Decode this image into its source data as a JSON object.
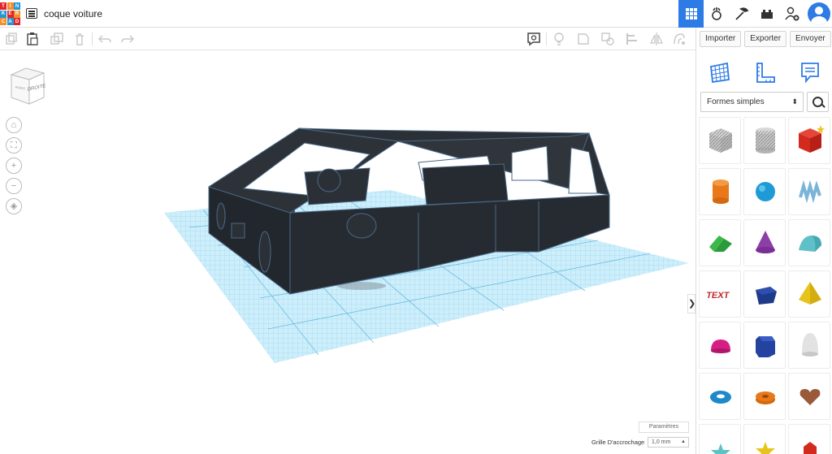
{
  "header": {
    "logo_letters": [
      "T",
      "I",
      "N",
      "K",
      "E",
      "R",
      "C",
      "A",
      "D"
    ],
    "logo_colors": [
      "#e2232a",
      "#f38f2a",
      "#2596d5",
      "#2596d5",
      "#e2232a",
      "#f38f2a",
      "#f38f2a",
      "#2596d5",
      "#e2232a"
    ],
    "title": "coque voiture",
    "right_icons": [
      "grid-view-icon",
      "simulate-icon",
      "build-icon",
      "bricks-icon",
      "add-user-icon",
      "avatar"
    ]
  },
  "toolbar": {
    "left_tools": [
      "copy-icon",
      "paste-icon",
      "duplicate-icon",
      "delete-icon",
      "undo-icon",
      "redo-icon"
    ],
    "right_tools": [
      "note-icon",
      "light-icon",
      "shape-icon",
      "group-icon",
      "align-icon",
      "mirror-icon",
      "cruise-icon"
    ]
  },
  "panel": {
    "import_label": "Importer",
    "export_label": "Exporter",
    "send_label": "Envoyer",
    "category": "Formes simples",
    "shapes": [
      {
        "name": "box-hole",
        "color": "#b8b8b8"
      },
      {
        "name": "cylinder-hole",
        "color": "#b8b8b8"
      },
      {
        "name": "box",
        "color": "#d32a1e"
      },
      {
        "name": "cylinder",
        "color": "#e8781a"
      },
      {
        "name": "sphere",
        "color": "#1e9ad6"
      },
      {
        "name": "scribble",
        "color": "#7ab4d8"
      },
      {
        "name": "roof",
        "color": "#2a9a3a"
      },
      {
        "name": "cone",
        "color": "#8d3fa8"
      },
      {
        "name": "round-roof",
        "color": "#5fc0c8"
      },
      {
        "name": "text",
        "color": "#c0262c"
      },
      {
        "name": "polygon",
        "color": "#1f3a8a"
      },
      {
        "name": "pyramid",
        "color": "#e8c31a"
      },
      {
        "name": "half-sphere",
        "color": "#d61e83"
      },
      {
        "name": "hexagonal-prism",
        "color": "#2443a0"
      },
      {
        "name": "paraboloid",
        "color": "#d8d8d8"
      },
      {
        "name": "torus",
        "color": "#1e88c8"
      },
      {
        "name": "tube",
        "color": "#e8781a"
      },
      {
        "name": "heart",
        "color": "#9a5a3a"
      },
      {
        "name": "star",
        "color": "#5fc0c8"
      },
      {
        "name": "star-gold",
        "color": "#e8c31a"
      },
      {
        "name": "gem",
        "color": "#d32a1e"
      }
    ]
  },
  "workplane": {
    "viewcube_label": "DROITE",
    "viewcube_side_label": "AVANT",
    "params_label": "Paramètres",
    "grid_label": "Grille D'accrochage",
    "grid_value": "1,0 mm"
  }
}
